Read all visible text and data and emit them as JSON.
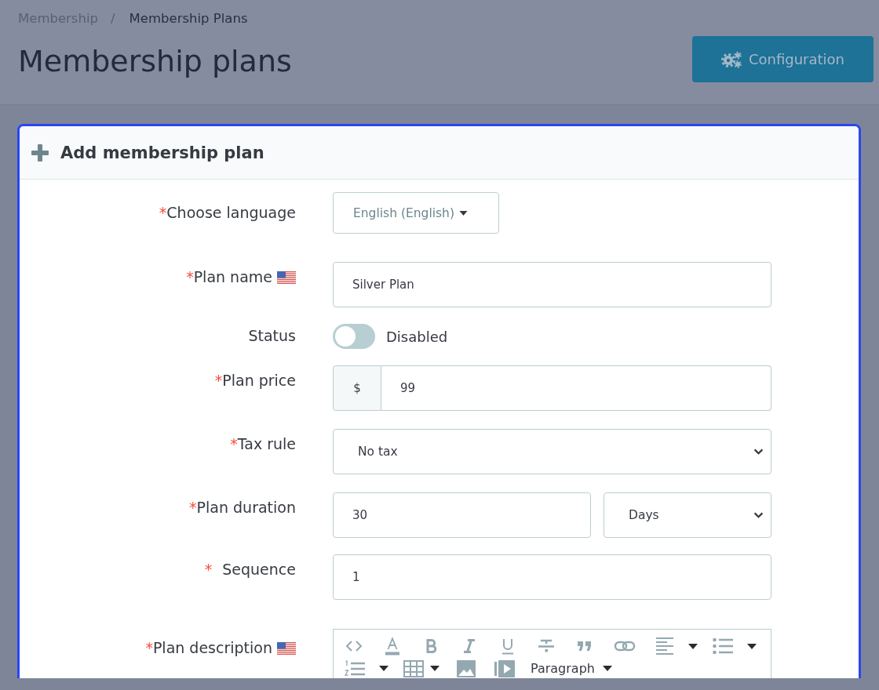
{
  "breadcrumb": {
    "items": [
      {
        "label": "Membership",
        "current": false
      },
      {
        "label": "Membership Plans",
        "current": true
      }
    ],
    "separator": "/"
  },
  "page_title": "Membership plans",
  "header_button": {
    "label": "Configuration"
  },
  "card": {
    "title": "Add membership plan",
    "fields": [
      {
        "kind": "dropdown",
        "required_mark": "*",
        "label": "Choose language",
        "flag": false,
        "value": "English (English)"
      },
      {
        "kind": "text",
        "required_mark": "*",
        "label": "Plan name",
        "flag": true,
        "value": "Silver Plan"
      },
      {
        "kind": "switch",
        "label": "Status",
        "flag": false,
        "on": false,
        "state_label": "Disabled"
      },
      {
        "kind": "price",
        "required_mark": "*",
        "label": "Plan price",
        "flag": false,
        "prefix": "$",
        "value": "99"
      },
      {
        "kind": "select",
        "required_mark": "*",
        "label": "Tax rule",
        "flag": false,
        "value": "No tax"
      },
      {
        "kind": "duration",
        "required_mark": "*",
        "label": "Plan duration",
        "flag": false,
        "value": "30",
        "unit": "Days"
      },
      {
        "kind": "number",
        "required_mark": "*",
        "label": "Sequence",
        "flag": false,
        "value": "1"
      },
      {
        "kind": "editor",
        "required_mark": "*",
        "label": "Plan description",
        "flag": true,
        "block_format": "Paragraph"
      }
    ]
  }
}
